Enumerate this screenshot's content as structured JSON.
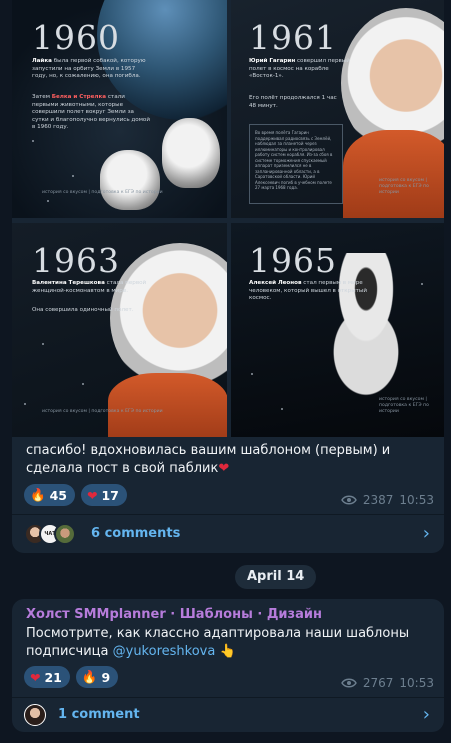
{
  "message1": {
    "tiles": [
      {
        "year": "1960",
        "p1_name": "Лайка",
        "p1_rest": " была первой собакой, которую запустили на орбиту Земли в 1957 году, но, к сожалению, она погибла.",
        "p2_pre": "Затем ",
        "p2_hl": "Белка и Стрелка",
        "p2_rest": " стали первыми животными, которые совершили полет вокруг Земли за сутки и благополучно вернулись домой в 1960 году.",
        "credit": "история со вкусом | подготовка к ЕГЭ по истории"
      },
      {
        "year": "1961",
        "p1_name": "Юрий Гагарин",
        "p1_rest": " совершил первый полет в космос на корабле «Восток-1».",
        "p2": "Его полёт продолжался 1 час 48 минут.",
        "box": "Во время полёта Гагарин поддерживал радиосвязь с Землёй, наблюдал за планетой через иллюминаторы и контролировал работу систем корабля. Из-за сбоя в системе торможения спускаемый аппарат приземлился не в запланированной области, а в Саратовской области. Юрий Алексеевич погиб в учебном полете 27 марта 1968 года.",
        "credit": "история со вкусом | подготовка к ЕГЭ по истории"
      },
      {
        "year": "1963",
        "p1_name": "Валентина Терешкова",
        "p1_rest": " стала первой женщиной-космонавтом в мире.",
        "p2": "Она совершила одиночный полет.",
        "credit": "история со вкусом | подготовка к ЕГЭ по истории"
      },
      {
        "year": "1965",
        "p1_name": "Алексей Леонов",
        "p1_rest": " стал первым в мире человеком, который вышел в открытый космос.",
        "credit": "история со вкусом | подготовка к ЕГЭ по истории"
      }
    ],
    "caption_text": "спасибо! вдохновилась  вашим шаблоном (первым) и сделала пост в свой паблик",
    "caption_emoji": "❤",
    "reactions": [
      {
        "emoji": "🔥",
        "count": "45"
      },
      {
        "emoji": "❤",
        "count": "17"
      }
    ],
    "views": "2387",
    "time": "10:53",
    "avatar_text": "ЧАТ ПАСТА",
    "comments_label": "6 comments"
  },
  "date_separator": "April 14",
  "message2": {
    "forwarded_from": "Холст SMMplanner · Шаблоны · Дизайн",
    "text": "Посмотрите, как классно адаптировала наши шаблоны подписчица ",
    "mention": "@yukoreshkova",
    "hand": "👆",
    "reactions": [
      {
        "emoji": "❤",
        "count": "21"
      },
      {
        "emoji": "🔥",
        "count": "9"
      }
    ],
    "views": "2767",
    "time": "10:53",
    "comments_label": "1 comment"
  },
  "colors": {
    "background": "#0e1621",
    "bubble": "#182533",
    "reaction_pill": "#2b5278",
    "link": "#64b5ef",
    "forward_name": "#b67cdb",
    "meta": "#6d7f8f"
  },
  "icons": {
    "views": "eye-icon",
    "comments_chevron": "chevron-right-icon"
  }
}
